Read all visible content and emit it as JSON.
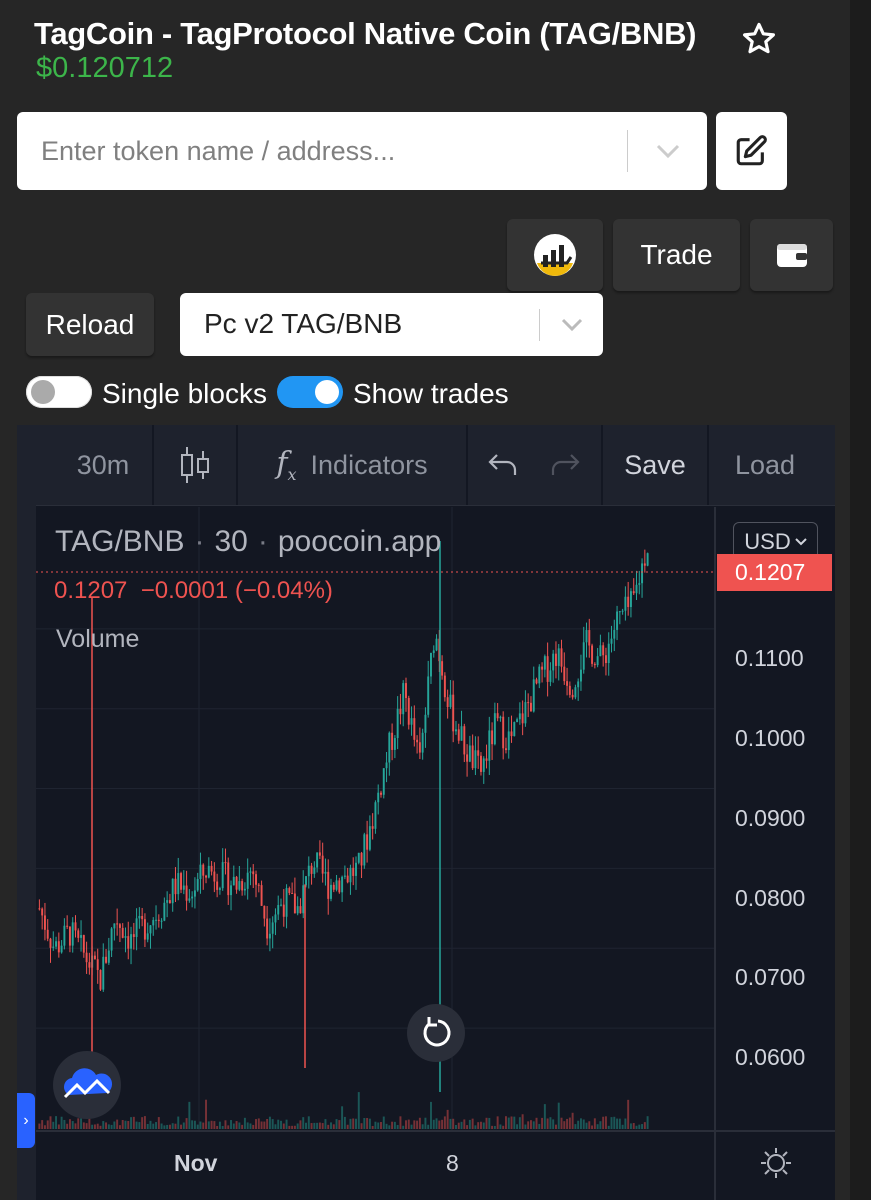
{
  "header": {
    "title": "TagCoin - TagProtocol Native Coin (TAG/BNB)",
    "price": "$0.120712"
  },
  "search": {
    "placeholder": "Enter token name / address..."
  },
  "buttons": {
    "trade": "Trade",
    "reload": "Reload"
  },
  "pair_select": {
    "value": "Pc v2 TAG/BNB"
  },
  "toggles": {
    "single_blocks": {
      "label": "Single blocks",
      "on": false
    },
    "show_trades": {
      "label": "Show trades",
      "on": true
    }
  },
  "toolbar": {
    "interval": "30m",
    "indicators": "Indicators",
    "save": "Save",
    "load": "Load"
  },
  "legend": {
    "symbol": "TAG/BNB",
    "interval": "30",
    "source": "poocoin.app",
    "last": "0.1207",
    "change": "−0.0001",
    "change_pct": "(−0.04%)",
    "volume_label": "Volume"
  },
  "currency": "USD",
  "colors": {
    "up": "#26a69a",
    "down": "#ef5350",
    "price_green": "#3cb54a",
    "toggle_on": "#2196f3"
  },
  "chart_data": {
    "type": "candlestick",
    "symbol": "TAG/BNB",
    "interval": "30",
    "y_axis": {
      "labels": [
        "0.1100",
        "0.1000",
        "0.0900",
        "0.0800",
        "0.0700",
        "0.0600"
      ],
      "range": [
        0.051,
        0.122
      ]
    },
    "x_axis": {
      "labels": [
        "Nov",
        "8"
      ]
    },
    "last_price": "0.1207",
    "price_path_approx": [
      0.075,
      0.07,
      0.072,
      0.069,
      0.066,
      0.074,
      0.071,
      0.073,
      0.075,
      0.078,
      0.077,
      0.08,
      0.079,
      0.078,
      0.08,
      0.073,
      0.076,
      0.075,
      0.081,
      0.078,
      0.079,
      0.08,
      0.087,
      0.095,
      0.102,
      0.093,
      0.11,
      0.1,
      0.095,
      0.092,
      0.098,
      0.096,
      0.1,
      0.104,
      0.107,
      0.103,
      0.108,
      0.106,
      0.111,
      0.113,
      0.1207
    ],
    "grid": true
  }
}
